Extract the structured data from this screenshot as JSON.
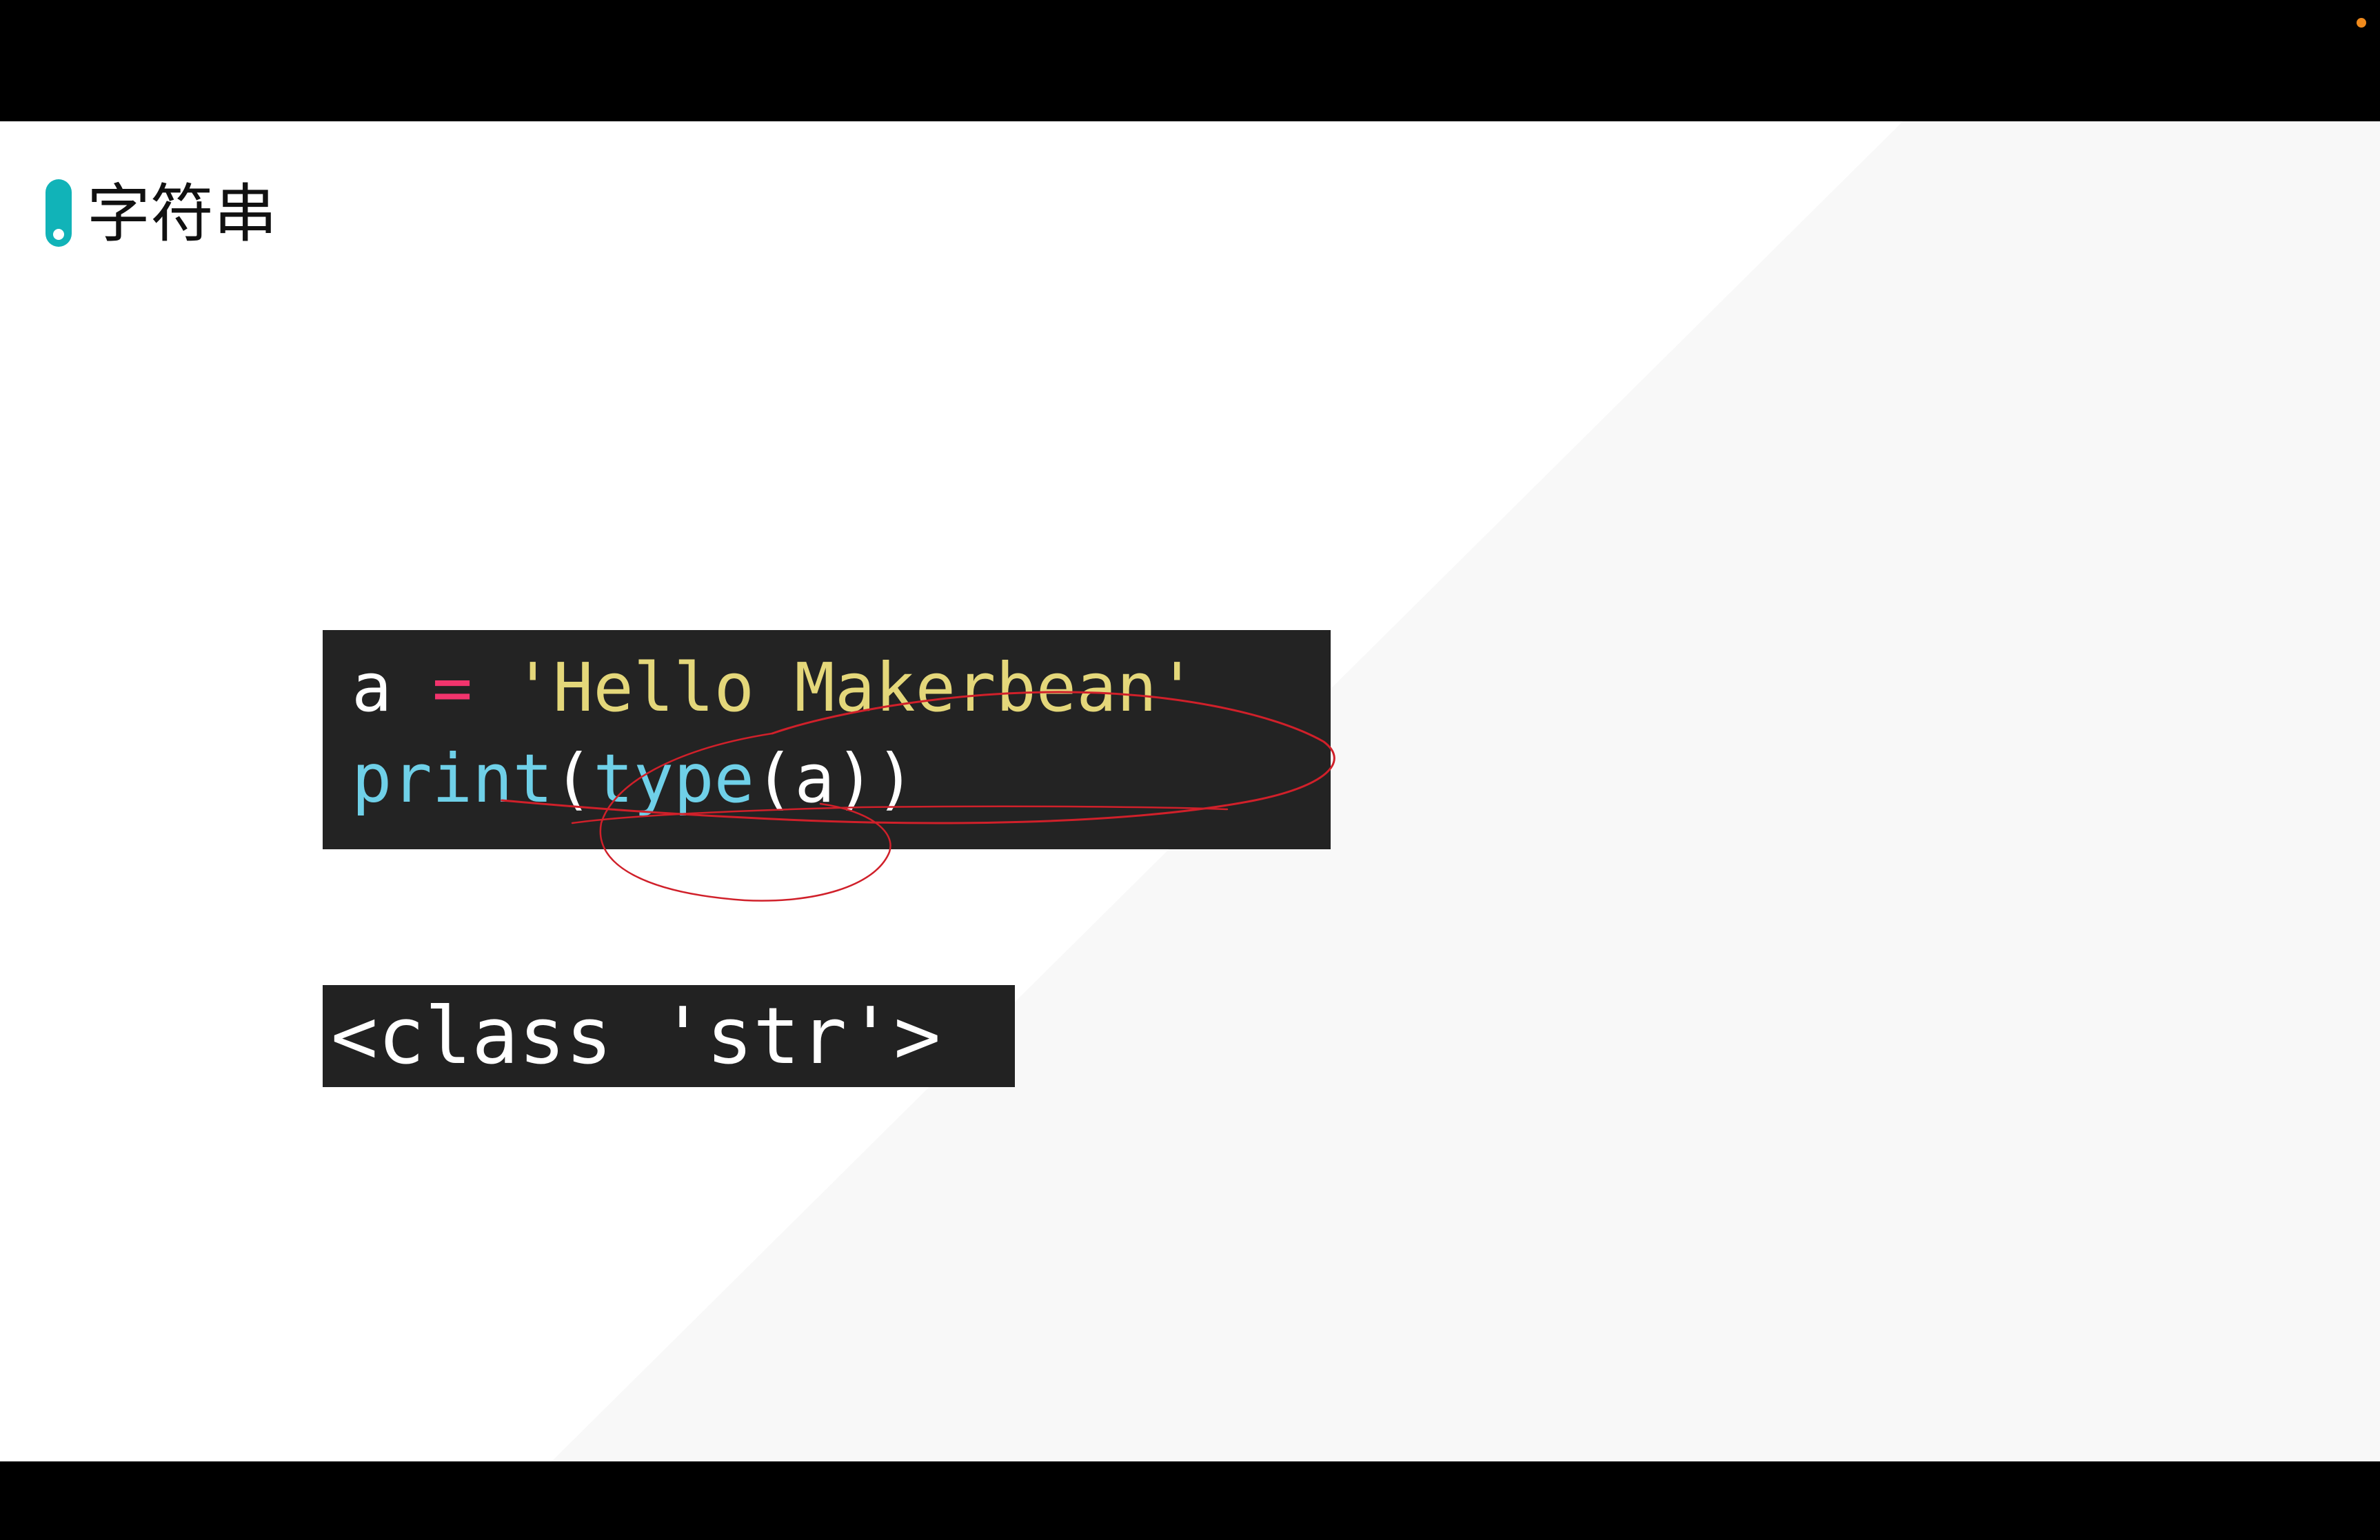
{
  "slide": {
    "title": "字符串",
    "code": {
      "line1": {
        "var": "a",
        "op": "=",
        "str": "'Hello Makerbean'"
      },
      "line2": {
        "print": "print",
        "open1": "(",
        "type": "type",
        "open2": "(",
        "arg": "a",
        "close": "))"
      }
    },
    "output": "<class 'str'>"
  },
  "colors": {
    "accent": "#11b3b8",
    "annotation": "#d0202a",
    "recording": "#f08a1c",
    "string": "#e4d77a",
    "function": "#6fd0e8",
    "operator": "#f2346d"
  },
  "icons": {
    "recording": "recording-dot-icon",
    "title_marker": "title-marker-icon"
  }
}
